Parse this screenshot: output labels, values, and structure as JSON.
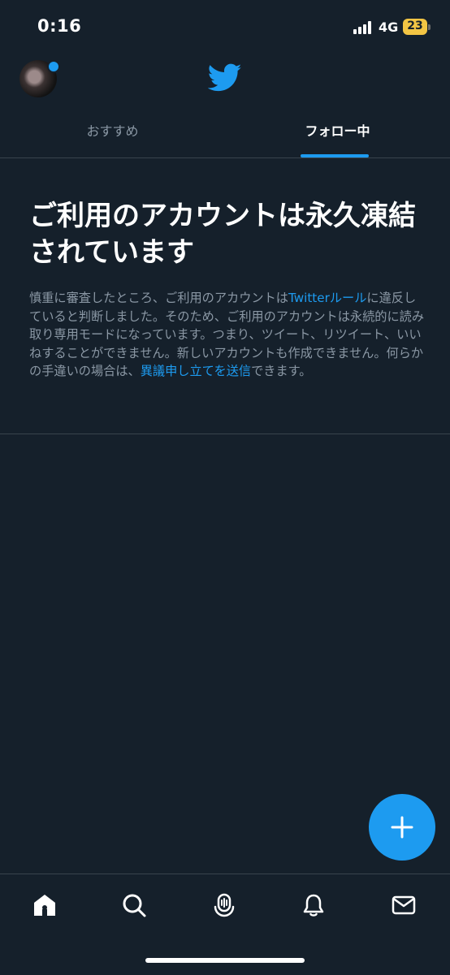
{
  "status_bar": {
    "time": "0:16",
    "network": "4G",
    "battery": "23"
  },
  "header": {
    "avatar_icon": "user-avatar",
    "logo_icon": "twitter-bird-icon"
  },
  "tabs": [
    {
      "label": "おすすめ",
      "selected": false
    },
    {
      "label": "フォロー中",
      "selected": true
    }
  ],
  "message": {
    "headline": "ご利用のアカウントは永久凍結されています",
    "body_part1": "慎重に審査したところ、ご利用のアカウントは",
    "rules_link": "Twitterルール",
    "body_part2": "に違反していると判断しました。そのため、ご利用のアカウントは永続的に読み取り専用モードになっています。つまり、ツイート、リツイート、いいねすることができません。新しいアカウントも作成できません。何らかの手違いの場合は、",
    "appeal_link": "異議申し立てを送信",
    "body_part3": "できます。"
  },
  "fab": {
    "icon": "plus-icon"
  },
  "bottom_nav": [
    {
      "icon": "home-icon",
      "active": true
    },
    {
      "icon": "search-icon",
      "active": false
    },
    {
      "icon": "spaces-icon",
      "active": false
    },
    {
      "icon": "bell-icon",
      "active": false
    },
    {
      "icon": "mail-icon",
      "active": false
    }
  ],
  "colors": {
    "background": "#15202b",
    "accent": "#1d9bf0",
    "secondary_text": "#8b98a5",
    "border": "#38444d"
  }
}
